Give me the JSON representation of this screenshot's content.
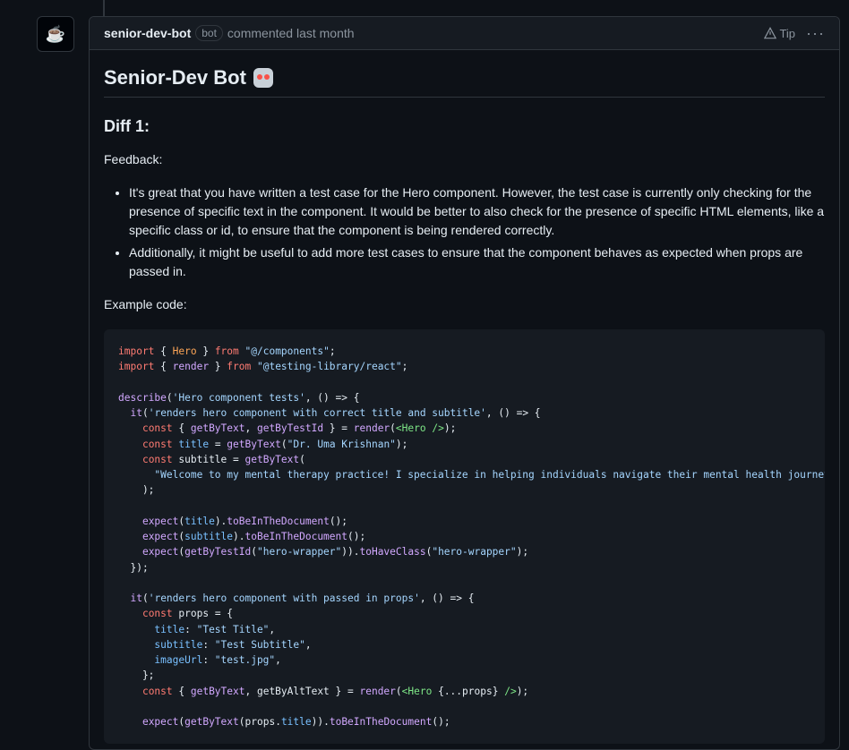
{
  "comment": {
    "author": "senior-dev-bot",
    "badge": "bot",
    "meta": "commented last month",
    "tip_label": "Tip",
    "more_label": "···"
  },
  "content": {
    "title": "Senior-Dev Bot",
    "heading": "Diff 1:",
    "feedback_label": "Feedback:",
    "bullets": [
      "It's great that you have written a test case for the Hero component. However, the test case is currently only checking for the presence of specific text in the component. It would be better to also check for the presence of specific HTML elements, like a specific class or id, to ensure that the component is being rendered correctly.",
      "Additionally, it might be useful to add more test cases to ensure that the component behaves as expected when props are passed in."
    ],
    "example_label": "Example code:",
    "code_lines": [
      "import { Hero } from \"@/components\";",
      "import { render } from \"@testing-library/react\";",
      "",
      "describe('Hero component tests', () => {",
      "  it('renders hero component with correct title and subtitle', () => {",
      "    const { getByText, getByTestId } = render(<Hero />);",
      "    const title = getByText(\"Dr. Uma Krishnan\");",
      "    const subtitle = getByText(",
      "      \"Welcome to my mental therapy practice! I specialize in helping individuals navigate their mental health journey and",
      "    );",
      "",
      "    expect(title).toBeInTheDocument();",
      "    expect(subtitle).toBeInTheDocument();",
      "    expect(getByTestId(\"hero-wrapper\")).toHaveClass(\"hero-wrapper\");",
      "  });",
      "",
      "  it('renders hero component with passed in props', () => {",
      "    const props = {",
      "      title: \"Test Title\",",
      "      subtitle: \"Test Subtitle\",",
      "      imageUrl: \"test.jpg\",",
      "    };",
      "    const { getByText, getByAltText } = render(<Hero {...props} />);",
      "",
      "    expect(getByText(props.title)).toBeInTheDocument();"
    ]
  },
  "icons": {
    "avatar": "mug-icon",
    "tip": "warning-triangle-icon",
    "more": "kebab-icon"
  }
}
